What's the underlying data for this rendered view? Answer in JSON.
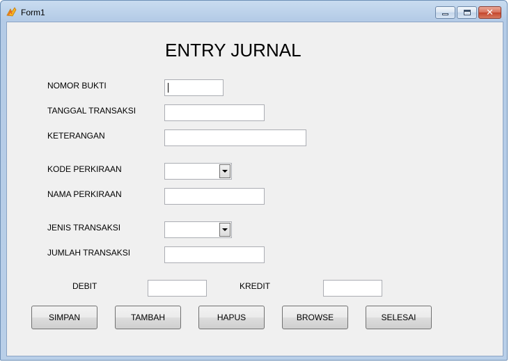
{
  "window": {
    "title": "Form1",
    "controls": {
      "minimize_icon": "minimize-icon",
      "maximize_icon": "maximize-icon",
      "close_icon": "close-icon",
      "close_glyph": "✕"
    }
  },
  "form": {
    "heading": "ENTRY JURNAL",
    "fields": {
      "nomor_bukti": {
        "label": "NOMOR BUKTI",
        "value": ""
      },
      "tanggal_transaksi": {
        "label": "TANGGAL TRANSAKSI",
        "value": ""
      },
      "keterangan": {
        "label": "KETERANGAN",
        "value": ""
      },
      "kode_perkiraan": {
        "label": "KODE PERKIRAAN",
        "selected": ""
      },
      "nama_perkiraan": {
        "label": "NAMA PERKIRAAN",
        "value": ""
      },
      "jenis_transaksi": {
        "label": "JENIS TRANSAKSI",
        "selected": ""
      },
      "jumlah_transaksi": {
        "label": "JUMLAH TRANSAKSI",
        "value": ""
      },
      "debit": {
        "label": "DEBIT",
        "value": ""
      },
      "kredit": {
        "label": "KREDIT",
        "value": ""
      }
    },
    "buttons": {
      "simpan": "SIMPAN",
      "tambah": "TAMBAH",
      "hapus": "HAPUS",
      "browse": "BROWSE",
      "selesai": "SELESAI"
    }
  }
}
